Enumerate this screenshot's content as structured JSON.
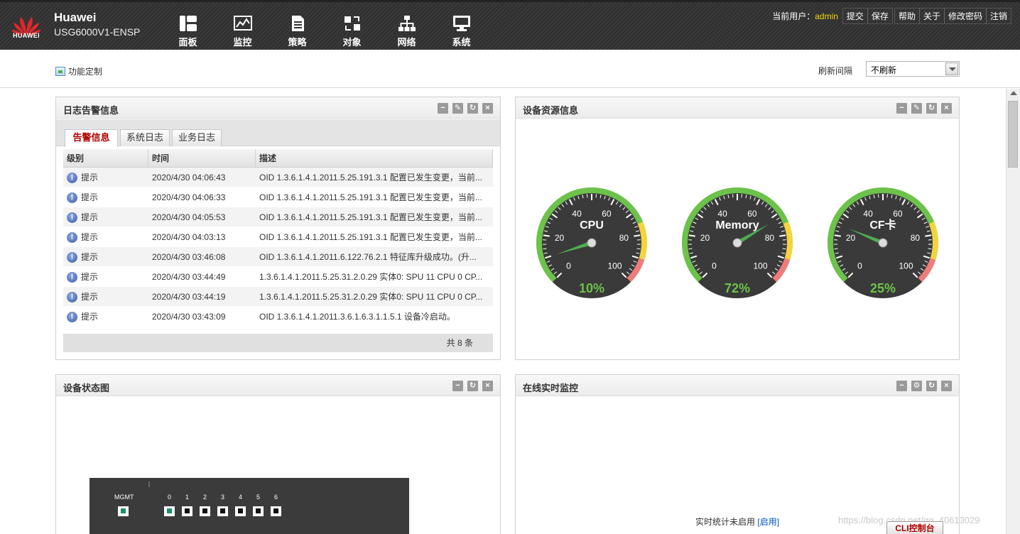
{
  "header": {
    "logo_text": "HUAWEI",
    "brand_name": "Huawei",
    "device_model": "USG6000V1-ENSP",
    "nav": [
      {
        "label": "面板",
        "icon": "dashboard-icon"
      },
      {
        "label": "监控",
        "icon": "monitor-chart-icon"
      },
      {
        "label": "策略",
        "icon": "policy-document-icon"
      },
      {
        "label": "对象",
        "icon": "objects-icon"
      },
      {
        "label": "网络",
        "icon": "network-topology-icon"
      },
      {
        "label": "系统",
        "icon": "system-computer-icon"
      }
    ],
    "user_label": "当前用户：",
    "username": "admin",
    "links": [
      "提交",
      "保存",
      "帮助",
      "关于",
      "修改密码",
      "注销"
    ]
  },
  "toolbar": {
    "customize_label": "功能定制",
    "refresh_label": "刷新间隔",
    "refresh_value": "不刷新"
  },
  "log_panel": {
    "title": "日志告警信息",
    "tabs": [
      "告警信息",
      "系统日志",
      "业务日志"
    ],
    "columns": [
      "级别",
      "时间",
      "描述"
    ],
    "rows": [
      {
        "level": "提示",
        "time": "2020/4/30 04:06:43",
        "desc": "OID 1.3.6.1.4.1.2011.5.25.191.3.1 配置已发生变更，当前..."
      },
      {
        "level": "提示",
        "time": "2020/4/30 04:06:33",
        "desc": "OID 1.3.6.1.4.1.2011.5.25.191.3.1 配置已发生变更，当前..."
      },
      {
        "level": "提示",
        "time": "2020/4/30 04:05:53",
        "desc": "OID 1.3.6.1.4.1.2011.5.25.191.3.1 配置已发生变更，当前..."
      },
      {
        "level": "提示",
        "time": "2020/4/30 04:03:13",
        "desc": "OID 1.3.6.1.4.1.2011.5.25.191.3.1 配置已发生变更，当前..."
      },
      {
        "level": "提示",
        "time": "2020/4/30 03:46:08",
        "desc": "OID 1.3.6.1.4.1.2011.6.122.76.2.1 特征库升级成功。(升..."
      },
      {
        "level": "提示",
        "time": "2020/4/30 03:44:49",
        "desc": "1.3.6.1.4.1.2011.5.25.31.2.0.29 实体0: SPU 11 CPU 0 CP..."
      },
      {
        "level": "提示",
        "time": "2020/4/30 03:44:19",
        "desc": "1.3.6.1.4.1.2011.5.25.31.2.0.29 实体0: SPU 11 CPU 0 CP..."
      },
      {
        "level": "提示",
        "time": "2020/4/30 03:43:09",
        "desc": "OID 1.3.6.1.4.1.2011.3.6.1.6.3.1.1.5.1 设备冷启动。"
      }
    ],
    "total": "共 8 条"
  },
  "resource_panel": {
    "title": "设备资源信息",
    "gauges": [
      {
        "label": "CPU",
        "value": 10,
        "display": "10%"
      },
      {
        "label": "Memory",
        "value": 72,
        "display": "72%"
      },
      {
        "label": "CF卡",
        "value": 25,
        "display": "25%"
      }
    ],
    "scale_labels": [
      "0",
      "20",
      "40",
      "60",
      "80",
      "100"
    ],
    "colors": {
      "green": "#6cc24a",
      "yellow": "#f2d43d",
      "red": "#ef7b7b",
      "dial": "#3a3a3a"
    }
  },
  "device_panel": {
    "title": "设备状态图",
    "mgmt_label": "MGMT",
    "port_numbers": [
      "0",
      "1",
      "2",
      "3",
      "4",
      "5",
      "6"
    ]
  },
  "realtime_panel": {
    "title": "在线实时监控",
    "status_text": "实时统计未启用",
    "enable_link": "[启用]"
  },
  "footer": {
    "watermark": "https://blog.csdn.net/qq_40613029",
    "cli_button": "CLI控制台"
  }
}
